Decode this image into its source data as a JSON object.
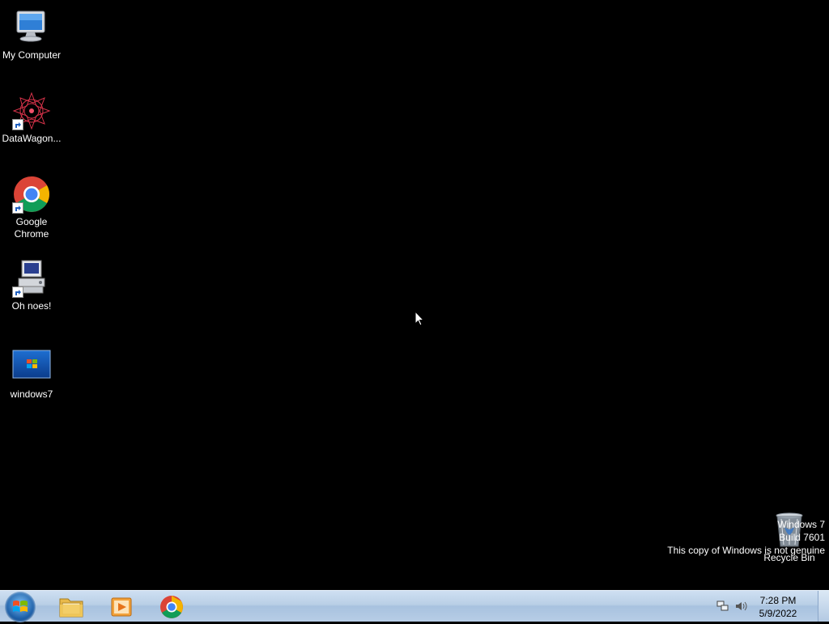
{
  "desktop": {
    "icons": [
      {
        "label": "My Computer",
        "icon": "computer-icon"
      },
      {
        "label": "DataWagon...",
        "icon": "datawagon-icon"
      },
      {
        "label": "Google Chrome",
        "icon": "chrome-icon"
      },
      {
        "label": "Oh noes!",
        "icon": "oh-noes-icon"
      },
      {
        "label": "windows7",
        "icon": "image-file-icon"
      },
      {
        "label": "Recycle Bin",
        "icon": "recycle-bin-icon"
      }
    ]
  },
  "watermark": {
    "line1": "Windows 7",
    "line2": "Build 7601",
    "line3": "This copy of Windows is not genuine"
  },
  "taskbar": {
    "pinned": [
      {
        "name": "file-explorer",
        "icon": "folder-icon"
      },
      {
        "name": "media-player",
        "icon": "media-player-icon"
      },
      {
        "name": "google-chrome",
        "icon": "chrome-icon"
      }
    ],
    "clock": {
      "time": "7:28 PM",
      "date": "5/9/2022"
    }
  }
}
